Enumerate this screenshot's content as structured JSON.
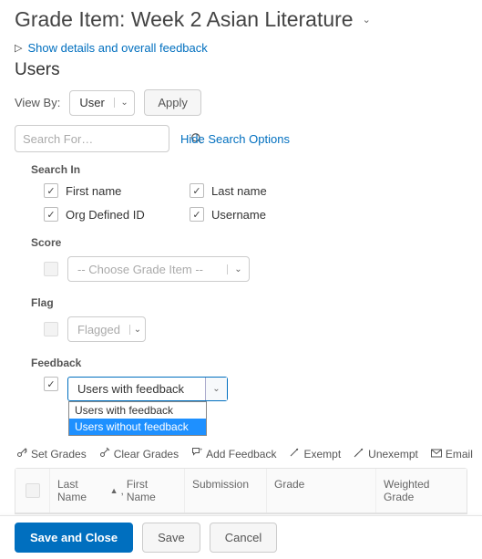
{
  "title": "Grade Item: Week 2 Asian Literature",
  "details_link": "Show details and overall feedback",
  "users_heading": "Users",
  "viewby": {
    "label": "View By:",
    "value": "User",
    "apply": "Apply"
  },
  "search": {
    "placeholder": "Search For…",
    "hide_link": "Hide Search Options"
  },
  "search_in": {
    "title": "Search In",
    "first_name": "First name",
    "last_name": "Last name",
    "org_id": "Org Defined ID",
    "username": "Username"
  },
  "score": {
    "title": "Score",
    "placeholder": "-- Choose Grade Item --"
  },
  "flag": {
    "title": "Flag",
    "placeholder": "Flagged"
  },
  "feedback": {
    "title": "Feedback",
    "selected": "Users with feedback",
    "options": [
      "Users with feedback",
      "Users without feedback"
    ]
  },
  "toolbar": {
    "set_grades": "Set Grades",
    "clear_grades": "Clear Grades",
    "add_feedback": "Add Feedback",
    "exempt": "Exempt",
    "unexempt": "Unexempt",
    "email": "Email"
  },
  "table": {
    "col_name_last": "Last Name",
    "col_name_first": "First Name",
    "col_submission": "Submission",
    "col_grade": "Grade",
    "col_weighted": "Weighted Grade"
  },
  "footer": {
    "save_close": "Save and Close",
    "save": "Save",
    "cancel": "Cancel"
  }
}
